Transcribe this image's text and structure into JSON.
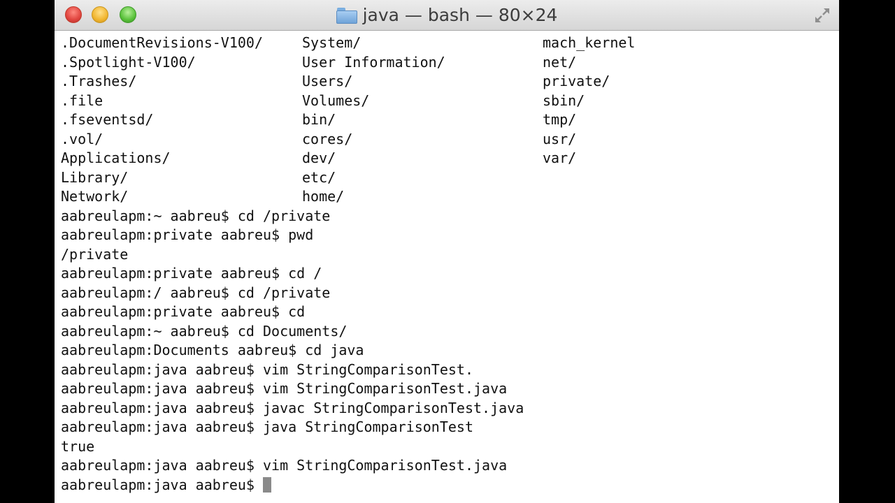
{
  "window": {
    "title": "java — bash — 80×24"
  },
  "listing": [
    [
      ".DocumentRevisions-V100/",
      "System/",
      "mach_kernel"
    ],
    [
      ".Spotlight-V100/",
      "User Information/",
      "net/"
    ],
    [
      ".Trashes/",
      "Users/",
      "private/"
    ],
    [
      ".file",
      "Volumes/",
      "sbin/"
    ],
    [
      ".fseventsd/",
      "bin/",
      "tmp/"
    ],
    [
      ".vol/",
      "cores/",
      "usr/"
    ],
    [
      "Applications/",
      "dev/",
      "var/"
    ],
    [
      "Library/",
      "etc/",
      ""
    ],
    [
      "Network/",
      "home/",
      ""
    ]
  ],
  "history": [
    "aabreulapm:~ aabreu$ cd /private",
    "aabreulapm:private aabreu$ pwd",
    "/private",
    "aabreulapm:private aabreu$ cd /",
    "aabreulapm:/ aabreu$ cd /private",
    "aabreulapm:private aabreu$ cd",
    "aabreulapm:~ aabreu$ cd Documents/",
    "aabreulapm:Documents aabreu$ cd java",
    "aabreulapm:java aabreu$ vim StringComparisonTest.",
    "aabreulapm:java aabreu$ vim StringComparisonTest.java",
    "aabreulapm:java aabreu$ javac StringComparisonTest.java",
    "aabreulapm:java aabreu$ java StringComparisonTest",
    "true",
    "aabreulapm:java aabreu$ vim StringComparisonTest.java"
  ],
  "prompt": {
    "text": "aabreulapm:java aabreu$"
  },
  "icons": {
    "title_icon": "folder-icon",
    "fullscreen": "fullscreen-icon"
  }
}
